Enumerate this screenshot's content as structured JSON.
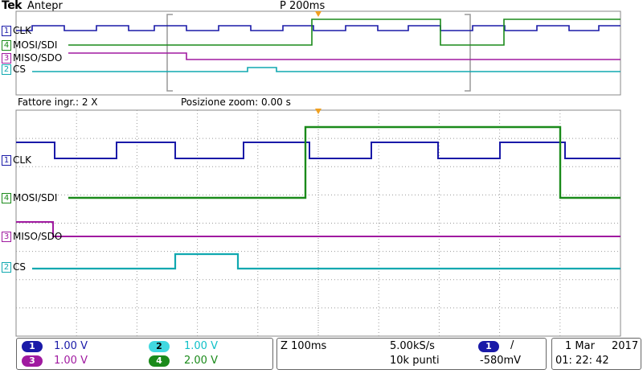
{
  "header": {
    "brand": "Tek",
    "mode": "Antepr",
    "horizontal_position": "P 200ms"
  },
  "channels": [
    {
      "num": "1",
      "label": "CLK",
      "color": "#1a1aa8"
    },
    {
      "num": "4",
      "label": "MOSI/SDI",
      "color": "#1a8a1a"
    },
    {
      "num": "3",
      "label": "MISO/SDO",
      "color": "#a01aa0"
    },
    {
      "num": "2",
      "label": "CS",
      "color": "#10a8b0"
    }
  ],
  "zoom": {
    "factor_text": "Fattore ingr.: 2 X",
    "position_text": "Posizione zoom: 0.00 s"
  },
  "footer": {
    "ch1_scale": "1.00 V",
    "ch2_scale": "1.00 V",
    "ch3_scale": "1.00 V",
    "ch4_scale": "2.00 V",
    "zoom_timebase": "Z 100ms",
    "sample_rate": "5.00kS/s",
    "record_length": "10k punti",
    "trigger_source": "1",
    "trigger_slope": "/",
    "trigger_level": "-580mV",
    "date_day_month": "1 Mar",
    "date_year": "2017",
    "time": "01: 22: 42"
  },
  "colors": {
    "ch1": "#1a1aa8",
    "ch2": "#10a8b0",
    "ch3": "#a01aa0",
    "ch4": "#1a8a1a",
    "trigger_marker": "#f0a020",
    "grid": "#9a9a9a"
  }
}
